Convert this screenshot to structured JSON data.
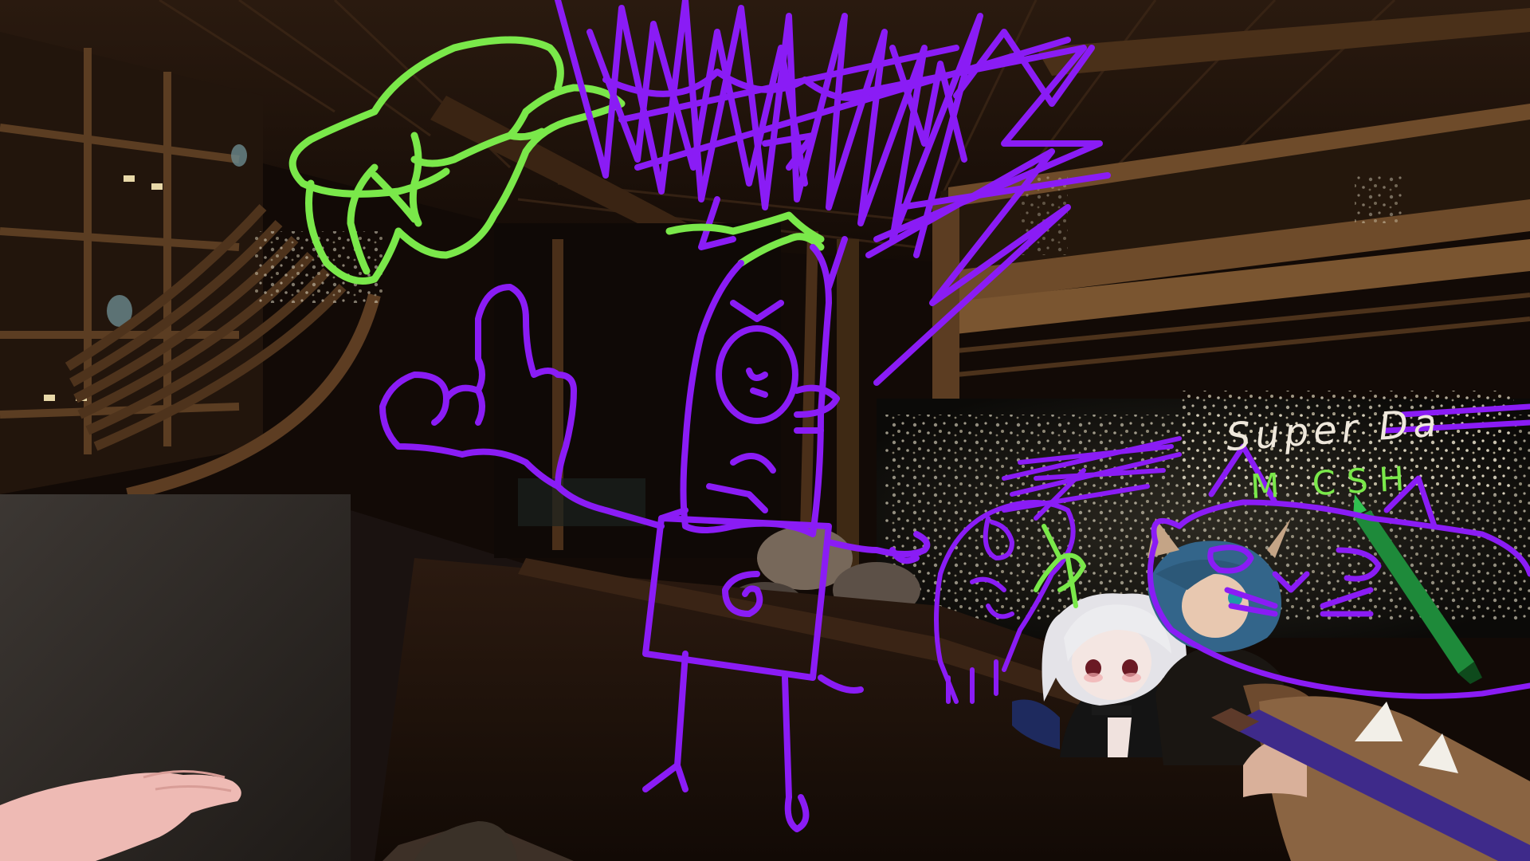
{
  "scene": {
    "description_free": true,
    "colors": {
      "purple_ink": "#8a1cf5",
      "green_ink": "#7ae84a",
      "white_ink": "#efe8dc",
      "wood_dark": "#1d120a",
      "wood_mid": "#3a2516",
      "wood_light": "#6b4a2c",
      "floor": "#2a2521",
      "skin": "#f0b9b3",
      "hair_white": "#e6e6ea",
      "hair_blue": "#3a6e8e"
    }
  },
  "drawings": {
    "white_text": "Super Da",
    "green_text": "M CSH"
  },
  "icons": {
    "hand": "player-hand",
    "pen": "drawing-pen"
  }
}
